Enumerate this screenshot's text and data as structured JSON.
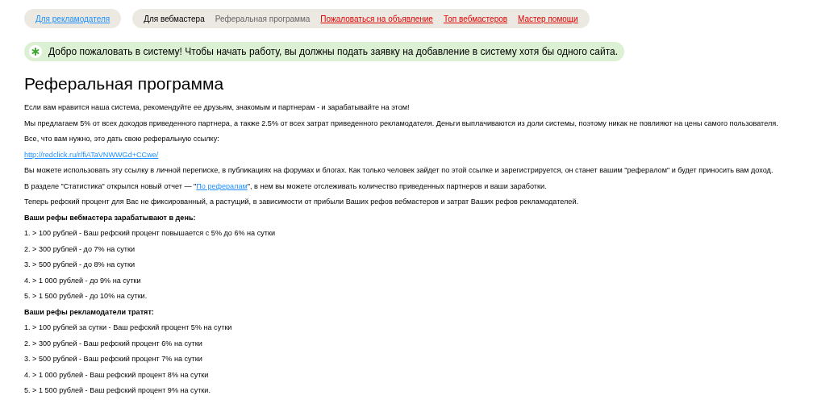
{
  "nav_groups": [
    {
      "items": [
        {
          "label": "Для рекламодателя",
          "kind": "section"
        }
      ]
    },
    {
      "items": [
        {
          "label": "Для вебмастера",
          "kind": "active"
        },
        {
          "label": "Реферальная программа",
          "kind": "current"
        },
        {
          "label": "Пожаловаться на объявление",
          "kind": "link"
        },
        {
          "label": "Топ вебмастеров",
          "kind": "link"
        },
        {
          "label": "Мастер помощи",
          "kind": "link"
        }
      ]
    }
  ],
  "notice": {
    "text": "Добро пожаловать в систему! Чтобы начать работу, вы должны подать заявку на добавление в систему хотя бы одного сайта."
  },
  "heading": "Реферальная программа",
  "paragraphs": [
    {
      "kind": "text",
      "parts": [
        {
          "kind": "text",
          "text": "Если вам нравится наша система, рекомендуйте ее друзьям, знакомым и партнерам - и зарабатывайте на этом!"
        }
      ]
    },
    {
      "kind": "text",
      "parts": [
        {
          "kind": "text",
          "text": "Мы предлагаем 5% от всех доходов приведенного партнера, а также 2.5% от всех затрат приведенного рекламодателя. Деньги выплачиваются из доли системы, поэтому никак не повлияют на цены самого пользователя."
        }
      ]
    },
    {
      "kind": "text",
      "parts": [
        {
          "kind": "text",
          "text": "Все, что вам нужно, это дать свою реферальную ссылку:"
        }
      ]
    },
    {
      "kind": "link",
      "text": "http://redclick.ru/r/fiATaVNWWGd+CCwe/"
    },
    {
      "kind": "text",
      "parts": [
        {
          "kind": "text",
          "text": "Вы можете использовать эту ссылку в личной переписке, в публикациях на форумах и блогах. Как только человек зайдет по этой ссылке и зарегистрируется, он станет вашим \"рефералом\" и будет приносить вам доход."
        }
      ]
    },
    {
      "kind": "text",
      "parts": [
        {
          "kind": "text",
          "text": "В разделе \"Статистика\" открылся новый отчет — \""
        },
        {
          "kind": "link",
          "text": "По рефералам"
        },
        {
          "kind": "text",
          "text": "\", в нем вы можете отслеживать количество приведенных партнеров и ваши заработки."
        }
      ]
    },
    {
      "kind": "text",
      "parts": [
        {
          "kind": "text",
          "text": "Теперь рефский процент для Вас не фиксированный, а растущий, в зависимости от прибыли Ваших рефов вебмастеров и затрат Ваших рефов рекламодателей."
        }
      ]
    },
    {
      "kind": "heading",
      "parts": [
        {
          "kind": "text",
          "text": "Ваши рефы вебмастера зарабатывают в день:"
        }
      ]
    },
    {
      "kind": "text",
      "parts": [
        {
          "kind": "text",
          "text": "1. > 100 рублей - Ваш рефский процент повышается с 5% до 6% на сутки"
        }
      ]
    },
    {
      "kind": "text",
      "parts": [
        {
          "kind": "text",
          "text": "2. > 300 рублей - до 7% на сутки"
        }
      ]
    },
    {
      "kind": "text",
      "parts": [
        {
          "kind": "text",
          "text": "3. > 500 рублей - до 8% на сутки"
        }
      ]
    },
    {
      "kind": "text",
      "parts": [
        {
          "kind": "text",
          "text": "4. > 1 000 рублей - до 9% на сутки"
        }
      ]
    },
    {
      "kind": "text",
      "parts": [
        {
          "kind": "text",
          "text": "5. > 1 500 рублей - до 10% на сутки."
        }
      ]
    },
    {
      "kind": "heading",
      "parts": [
        {
          "kind": "text",
          "text": "Ваши рефы рекламодатели тратят:"
        }
      ]
    },
    {
      "kind": "text",
      "parts": [
        {
          "kind": "text",
          "text": "1. > 100 рублей за сутки - Ваш рефский процент 5% на сутки"
        }
      ]
    },
    {
      "kind": "text",
      "parts": [
        {
          "kind": "text",
          "text": "2. > 300 рублей - Ваш рефский процент 6% на сутки"
        }
      ]
    },
    {
      "kind": "text",
      "parts": [
        {
          "kind": "text",
          "text": "3. > 500 рублей - Ваш рефский процент 7% на сутки"
        }
      ]
    },
    {
      "kind": "text",
      "parts": [
        {
          "kind": "text",
          "text": "4. > 1 000 рублей - Ваш рефский процент 8% на сутки"
        }
      ]
    },
    {
      "kind": "text",
      "parts": [
        {
          "kind": "text",
          "text": "5. > 1 500 рублей - Ваш рефский процент 9% на сутки."
        }
      ]
    }
  ]
}
